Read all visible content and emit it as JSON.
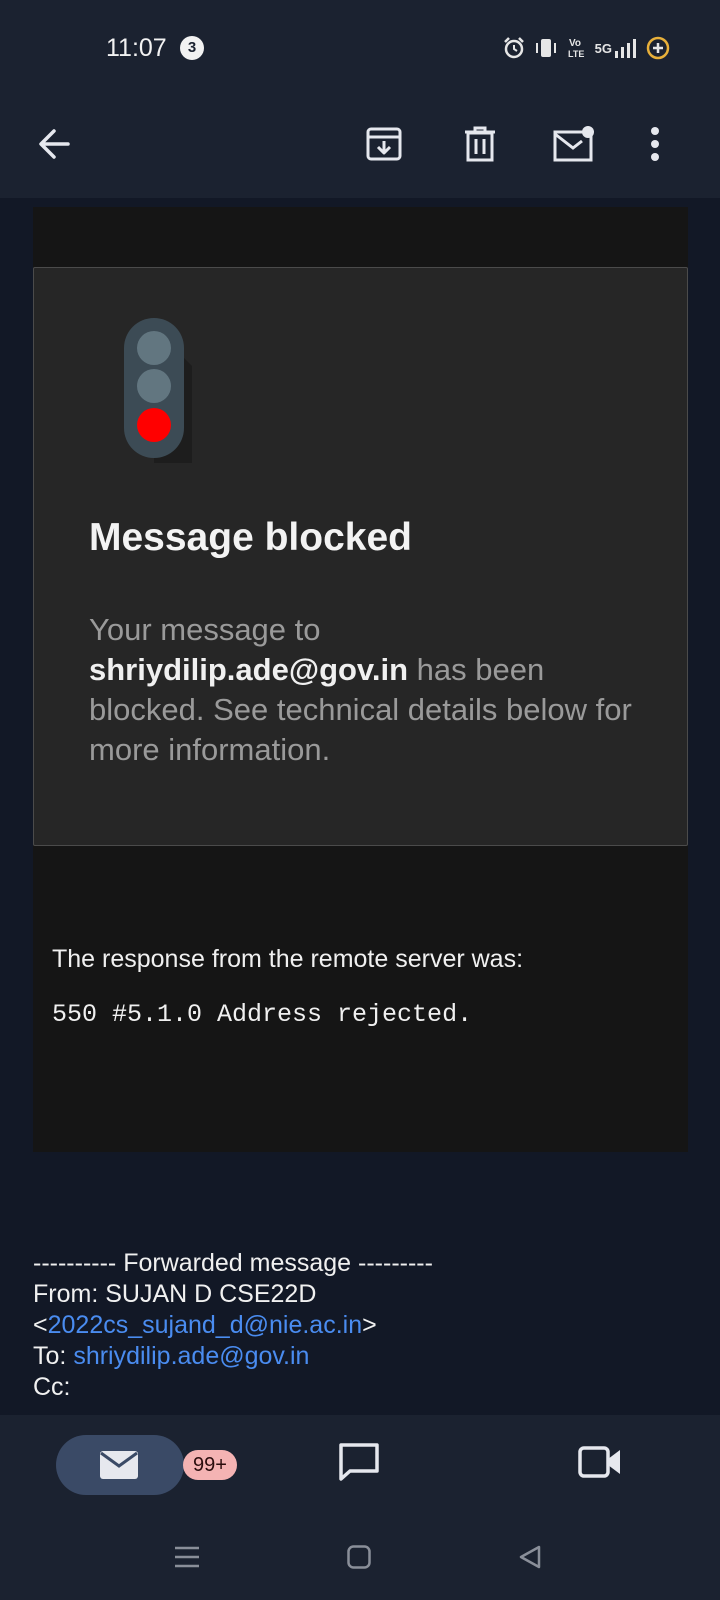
{
  "status_bar": {
    "time": "11:07",
    "notification_count": "3",
    "network": "5G"
  },
  "app_bar": {
    "back": "back-arrow",
    "actions": [
      "archive",
      "delete",
      "mark-unread",
      "more"
    ]
  },
  "blocked": {
    "title": "Message blocked",
    "line_intro": "Your message to",
    "recipient": "shriydilip.ade@gov.in",
    "line_rest": "has been blocked. See technical details below for more information."
  },
  "response": {
    "label": "The response from the remote server was:",
    "code": "550 #5.1.0 Address rejected."
  },
  "forwarded": {
    "header": "---------- Forwarded message ---------",
    "from_label": "From: SUJAN D CSE22D",
    "from_email": "2022cs_sujand_d@nie.ac.in",
    "to_label": "To:",
    "to_email": "shriydilip.ade@gov.in",
    "cc_label": "Cc:"
  },
  "bottom_nav": {
    "mail_badge": "99+"
  },
  "colors": {
    "link": "#4a8cf0",
    "traffic_red": "#ff0000",
    "badge_bg": "#f4b3b3"
  }
}
